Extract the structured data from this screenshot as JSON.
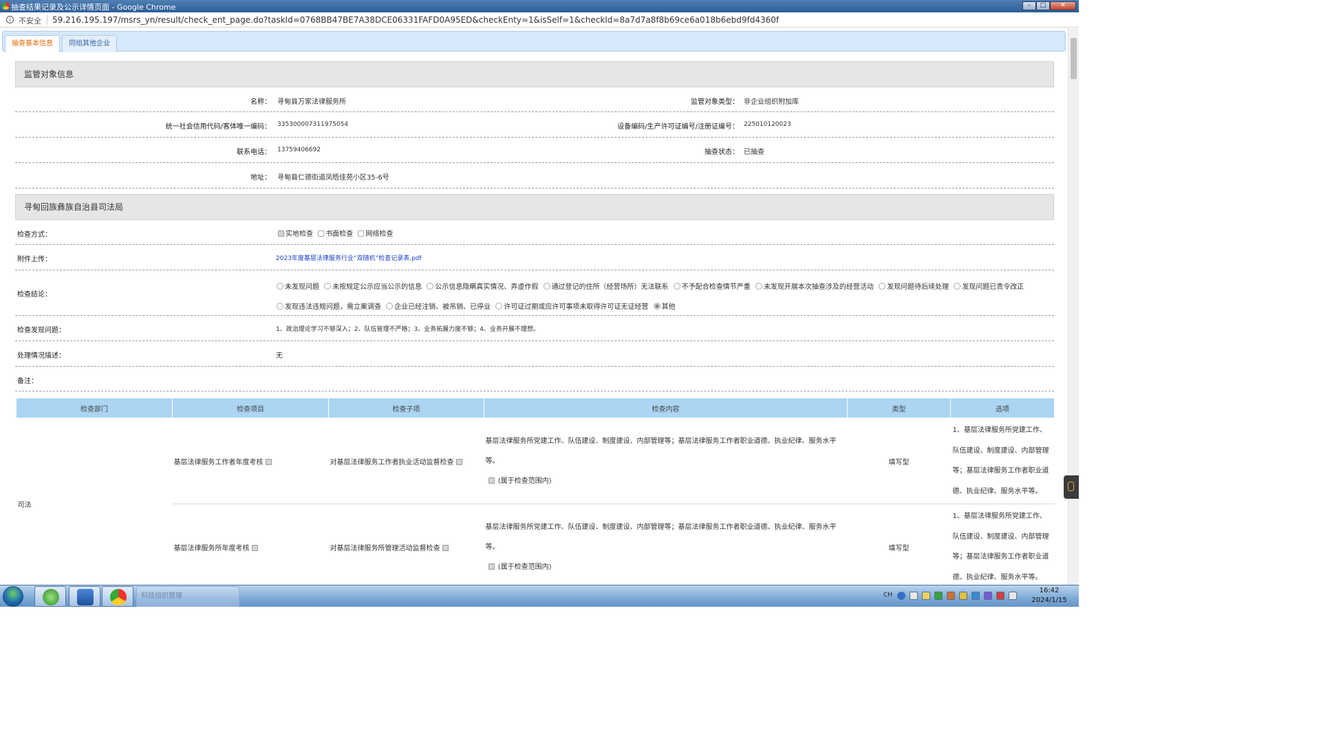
{
  "window": {
    "title": "抽查结果记录及公示详情页面 - Google Chrome"
  },
  "addressbar": {
    "security_label": "不安全",
    "url": "59.216.195.197/msrs_yn/result/check_ent_page.do?taskId=0768BB47BE7A38DCE06331FAFD0A95ED&checkEnty=1&isSelf=1&checkId=8a7d7a8f8b69ce6a018b6ebd9fd4360f"
  },
  "tabs": [
    {
      "label": "抽查基本信息",
      "active": true
    },
    {
      "label": "同组其他企业",
      "active": false
    }
  ],
  "subject": {
    "section_title": "监管对象信息",
    "name_label": "名称：",
    "name": "寻甸县万家法律服务所",
    "type_label": "监管对象类型：",
    "type": "非企业组织附加库",
    "credit_label": "统一社会信用代码/客体唯一编码：",
    "credit_code": "33530000731197505‌4",
    "device_label": "设备编码/生产许可证编号/注册证编号：",
    "device_no": "225010120023",
    "phone_label": "联系电话：",
    "phone": "13759406692",
    "status_label": "抽查状态：",
    "status": "已抽查",
    "address_label": "地址：",
    "address": "寻甸县仁德街道凤梧佳苑小区35-6号"
  },
  "inspection": {
    "section_title": "寻甸回族彝族自治县司法局",
    "method_label": "检查方式：",
    "methods": [
      {
        "label": "实地检查",
        "checked": true
      },
      {
        "label": "书面检查",
        "checked": false
      },
      {
        "label": "网络检查",
        "checked": false
      }
    ],
    "attachment_label": "附件上传：",
    "attachment_name": "2023年度基层法律服务行业“双随机”检查记录表.pdf",
    "conclusion_label": "检查结论：",
    "conclusions": [
      {
        "label": "未发现问题",
        "selected": false
      },
      {
        "label": "未按规定公示应当公示的信息",
        "selected": false
      },
      {
        "label": "公示信息隐瞒真实情况、弄虚作假",
        "selected": false
      },
      {
        "label": "通过登记的住所（经营场所）无法联系",
        "selected": false
      },
      {
        "label": "不予配合检查情节严重",
        "selected": false
      },
      {
        "label": "未发现开展本次抽查涉及的经营活动",
        "selected": false
      },
      {
        "label": "发现问题待后续处理",
        "selected": false
      },
      {
        "label": "发现问题已责令改正",
        "selected": false
      },
      {
        "label": "发现违法违规问题，需立案调查",
        "selected": false
      },
      {
        "label": "企业已经注销、被吊销、已停业",
        "selected": false
      },
      {
        "label": "许可证过期或应许可事项未取得许可证无证经营",
        "selected": false
      },
      {
        "label": "其他",
        "selected": true
      }
    ],
    "issues_label": "检查发现问题：",
    "issues": "1、政治理论学习不够深入；2、队伍管理不严格；3、业务拓展力度不够；4、业务开展不理想。",
    "handling_label": "处理情况描述：",
    "handling": "无",
    "remark_label": "备注：",
    "remark": ""
  },
  "table": {
    "headers": [
      "检查部门",
      "检查项目",
      "检查子项",
      "检查内容",
      "类型",
      "选项"
    ],
    "department": "司法",
    "rows": [
      {
        "item": "基层法律服务工作者年度考核",
        "subitem": "对基层法律服务工作者执业活动监督检查",
        "content": "基层法律服务所党建工作、队伍建设、制度建设、内部管理等；基层法律服务工作者职业道德、执业纪律、服务水平等。",
        "scope": "(属于检查范围内)",
        "type": "填写型",
        "option": "1、基层法律服务所党建工作、队伍建设、制度建设、内部管理等；基层法律服务工作者职业道德、执业纪律、服务水平等。"
      },
      {
        "item": "基层法律服务所年度考核",
        "subitem": "对基层法律服务所管理活动监督检查",
        "content": "基层法律服务所党建工作、队伍建设、制度建设、内部管理等；基层法律服务工作者职业道德、执业纪律、服务水平等。",
        "scope": "(属于检查范围内)",
        "type": "填写型",
        "option": "1、基层法律服务所党建工作、队伍建设、制度建设、内部管理等；基层法律服务工作者职业道德、执业纪律、服务水平等。"
      }
    ]
  },
  "taskbar": {
    "faded_item": "科技组织管理",
    "lang": "CH",
    "time": "16:42",
    "date": "2024/1/15"
  }
}
